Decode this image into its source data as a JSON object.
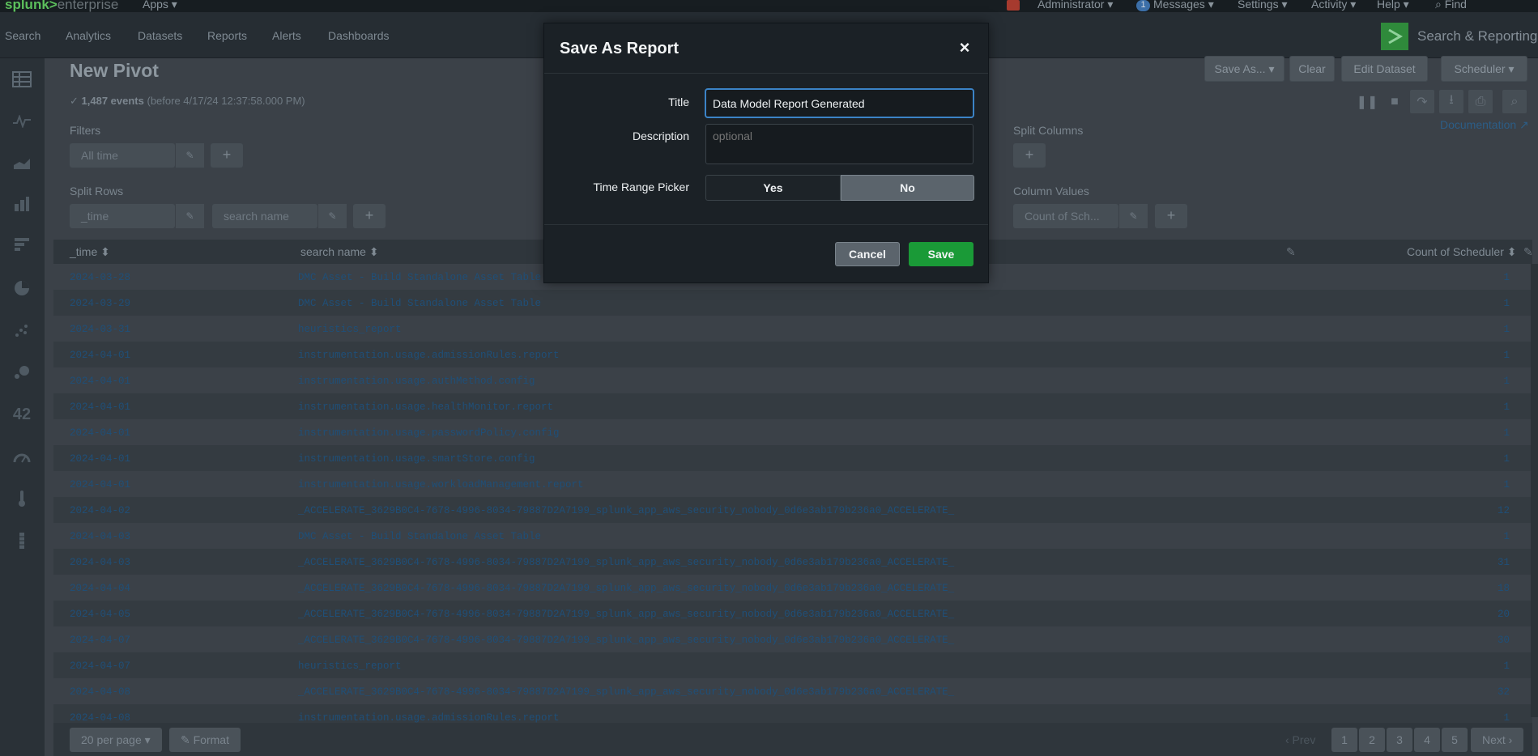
{
  "topbar": {
    "logo_a": "splunk>",
    "logo_b": "enterprise",
    "apps": "Apps ▾",
    "user": "Administrator ▾",
    "messages_count": "1",
    "messages": "Messages ▾",
    "settings": "Settings ▾",
    "activity": "Activity ▾",
    "help": "Help ▾",
    "find": "Find"
  },
  "appbar": {
    "nav": [
      "Search",
      "Analytics",
      "Datasets",
      "Reports",
      "Alerts",
      "Dashboards"
    ],
    "app_title": "Search & Reporting"
  },
  "sidebar_icons": [
    "table-icon",
    "pulse-icon",
    "area-chart-icon",
    "bar-chart-icon",
    "horizontal-bar-icon",
    "pie-chart-icon",
    "scatter-icon",
    "bubble-icon",
    "single-value-icon",
    "gauge-icon",
    "thermometer-icon",
    "marker-gauge-icon"
  ],
  "sidebar_single_value": "42",
  "pivot": {
    "title": "New Pivot",
    "events_count": "1,487 events",
    "events_range": "(before 4/17/24 12:37:58.000 PM)",
    "buttons": {
      "save_as": "Save As... ▾",
      "clear": "Clear",
      "edit_dataset": "Edit Dataset",
      "scheduler": "Scheduler ▾"
    },
    "documentation": "Documentation ↗",
    "filters_label": "Filters",
    "filter_pill": "All time",
    "split_rows_label": "Split Rows",
    "split_rows": [
      "_time",
      "search name"
    ],
    "split_columns_label": "Split Columns",
    "column_values_label": "Column Values",
    "column_value_pill": "Count of Sch..."
  },
  "table": {
    "headers": [
      "_time ⬍",
      "search name ⬍",
      "Count of Scheduler ⬍"
    ],
    "rows": [
      {
        "time": "2024-03-28",
        "name": "DMC Asset - Build Standalone Asset Table",
        "count": "1"
      },
      {
        "time": "2024-03-29",
        "name": "DMC Asset - Build Standalone Asset Table",
        "count": "1"
      },
      {
        "time": "2024-03-31",
        "name": "heuristics_report",
        "count": "1"
      },
      {
        "time": "2024-04-01",
        "name": "instrumentation.usage.admissionRules.report",
        "count": "1"
      },
      {
        "time": "2024-04-01",
        "name": "instrumentation.usage.authMethod.config",
        "count": "1"
      },
      {
        "time": "2024-04-01",
        "name": "instrumentation.usage.healthMonitor.report",
        "count": "1"
      },
      {
        "time": "2024-04-01",
        "name": "instrumentation.usage.passwordPolicy.config",
        "count": "1"
      },
      {
        "time": "2024-04-01",
        "name": "instrumentation.usage.smartStore.config",
        "count": "1"
      },
      {
        "time": "2024-04-01",
        "name": "instrumentation.usage.workloadManagement.report",
        "count": "1"
      },
      {
        "time": "2024-04-02",
        "name": "_ACCELERATE_3629B0C4-7678-4996-8034-79887D2A7199_splunk_app_aws_security_nobody_0d6e3ab179b236a0_ACCELERATE_",
        "count": "12"
      },
      {
        "time": "2024-04-03",
        "name": "DMC Asset - Build Standalone Asset Table",
        "count": "1"
      },
      {
        "time": "2024-04-03",
        "name": "_ACCELERATE_3629B0C4-7678-4996-8034-79887D2A7199_splunk_app_aws_security_nobody_0d6e3ab179b236a0_ACCELERATE_",
        "count": "31"
      },
      {
        "time": "2024-04-04",
        "name": "_ACCELERATE_3629B0C4-7678-4996-8034-79887D2A7199_splunk_app_aws_security_nobody_0d6e3ab179b236a0_ACCELERATE_",
        "count": "18"
      },
      {
        "time": "2024-04-05",
        "name": "_ACCELERATE_3629B0C4-7678-4996-8034-79887D2A7199_splunk_app_aws_security_nobody_0d6e3ab179b236a0_ACCELERATE_",
        "count": "20"
      },
      {
        "time": "2024-04-07",
        "name": "_ACCELERATE_3629B0C4-7678-4996-8034-79887D2A7199_splunk_app_aws_security_nobody_0d6e3ab179b236a0_ACCELERATE_",
        "count": "30"
      },
      {
        "time": "2024-04-07",
        "name": "heuristics_report",
        "count": "1"
      },
      {
        "time": "2024-04-08",
        "name": "_ACCELERATE_3629B0C4-7678-4996-8034-79887D2A7199_splunk_app_aws_security_nobody_0d6e3ab179b236a0_ACCELERATE_",
        "count": "32"
      },
      {
        "time": "2024-04-08",
        "name": "instrumentation.usage.admissionRules.report",
        "count": "1"
      }
    ]
  },
  "footer": {
    "per_page": "20 per page ▾",
    "format": "✎ Format",
    "prev": "‹ Prev",
    "pages": [
      "1",
      "2",
      "3",
      "4",
      "5"
    ],
    "next": "Next ›"
  },
  "modal": {
    "title": "Save As Report",
    "close": "×",
    "title_label": "Title",
    "title_value": "Data Model Report Generated",
    "description_label": "Description",
    "description_placeholder": "optional",
    "time_range_label": "Time Range Picker",
    "yes": "Yes",
    "no": "No",
    "selected": "No",
    "cancel": "Cancel",
    "save": "Save"
  },
  "colors": {
    "accent": "#3b83c6",
    "save_green": "#1a9a37",
    "brand_green": "#5cc05c"
  }
}
